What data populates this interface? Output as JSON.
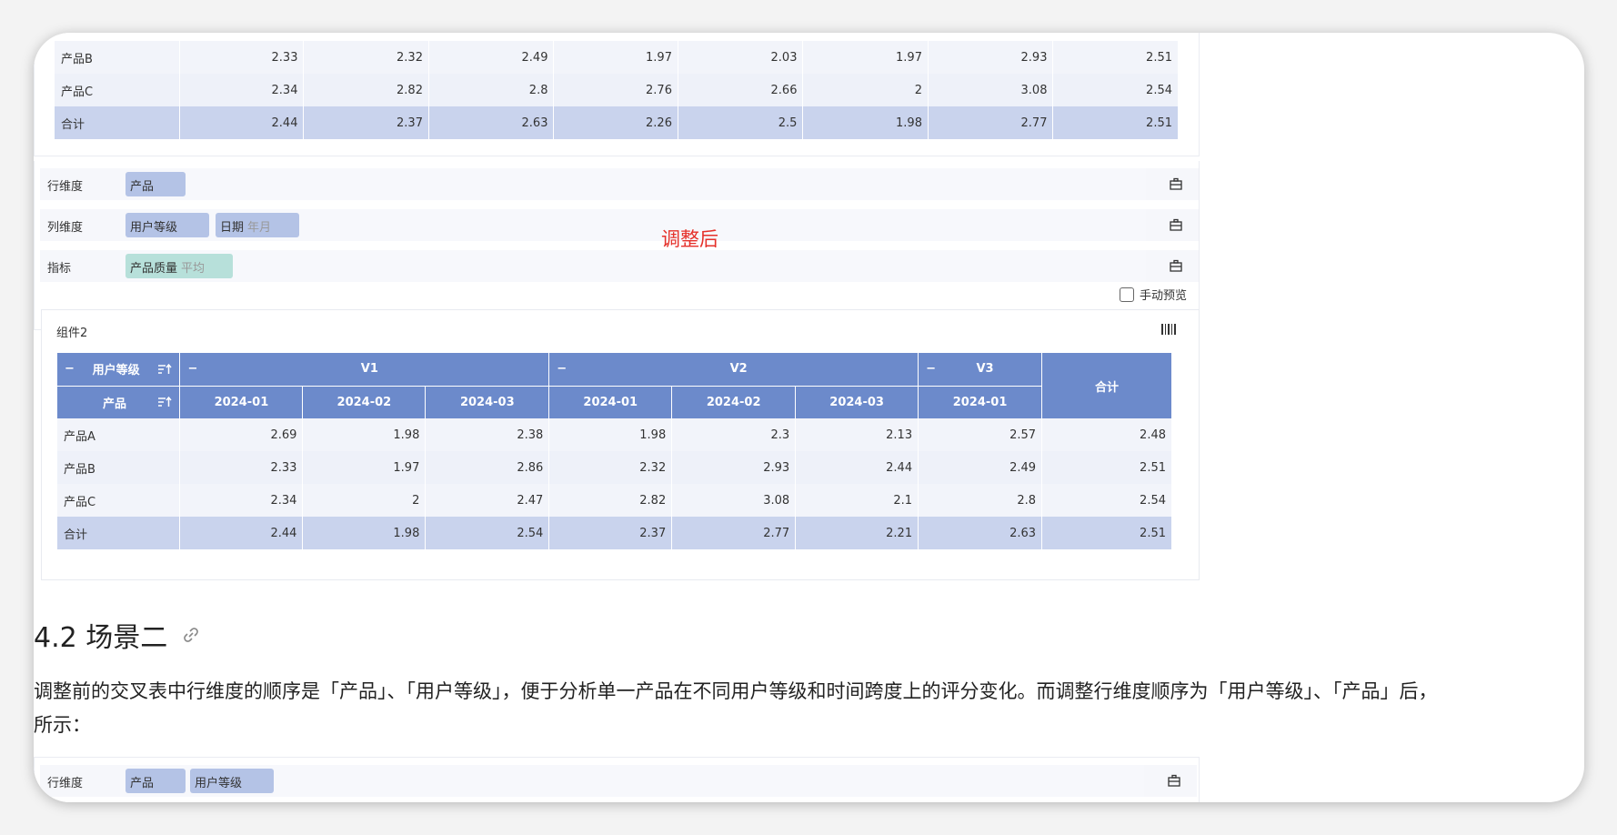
{
  "top_table": {
    "rows": [
      {
        "label": "产品B",
        "values": [
          "2.33",
          "2.32",
          "2.49",
          "1.97",
          "2.03",
          "1.97",
          "2.93",
          "2.51"
        ]
      },
      {
        "label": "产品C",
        "values": [
          "2.34",
          "2.82",
          "2.8",
          "2.76",
          "2.66",
          "2",
          "3.08",
          "2.54"
        ]
      },
      {
        "label": "合计",
        "values": [
          "2.44",
          "2.37",
          "2.63",
          "2.26",
          "2.5",
          "1.98",
          "2.77",
          "2.51"
        ]
      }
    ]
  },
  "dims": {
    "row": {
      "label": "行维度",
      "chips": [
        "产品"
      ]
    },
    "col": {
      "label": "列维度",
      "chips": [
        "用户等级",
        "日期"
      ],
      "chip2_sub": "年月"
    },
    "metric": {
      "label": "指标",
      "chip": "产品质量",
      "chip_sub": "平均"
    }
  },
  "note": "调整后",
  "manual_preview": "手动预览",
  "component": {
    "title": "组件2",
    "corner_top": "用户等级",
    "corner_bottom": "产品",
    "groups": [
      {
        "label": "V1",
        "months": [
          "2024-01",
          "2024-02",
          "2024-03"
        ]
      },
      {
        "label": "V2",
        "months": [
          "2024-01",
          "2024-02",
          "2024-03"
        ]
      },
      {
        "label": "V3",
        "months": [
          "2024-01"
        ]
      }
    ],
    "total_label": "合计",
    "minus": "−",
    "rows": [
      {
        "label": "产品A",
        "values": [
          "2.69",
          "1.98",
          "2.38",
          "1.98",
          "2.3",
          "2.13",
          "2.57",
          "2.48"
        ]
      },
      {
        "label": "产品B",
        "values": [
          "2.33",
          "1.97",
          "2.86",
          "2.32",
          "2.93",
          "2.44",
          "2.49",
          "2.51"
        ]
      },
      {
        "label": "产品C",
        "values": [
          "2.34",
          "2",
          "2.47",
          "2.82",
          "3.08",
          "2.1",
          "2.8",
          "2.54"
        ]
      },
      {
        "label": "合计",
        "values": [
          "2.44",
          "1.98",
          "2.54",
          "2.37",
          "2.77",
          "2.21",
          "2.63",
          "2.51"
        ]
      }
    ]
  },
  "section": {
    "heading": "4.2 场景二",
    "paragraph": "调整前的交叉表中行维度的顺序是「产品」、「用户等级」，便于分析单一产品在不同用户等级和时间跨度上的评分变化。而调整行维度顺序为「用户等级」、「产品」后，",
    "paragraph_2": "所示："
  },
  "bottom_dims": {
    "label": "行维度",
    "chips": [
      "产品",
      "用户等级"
    ]
  }
}
